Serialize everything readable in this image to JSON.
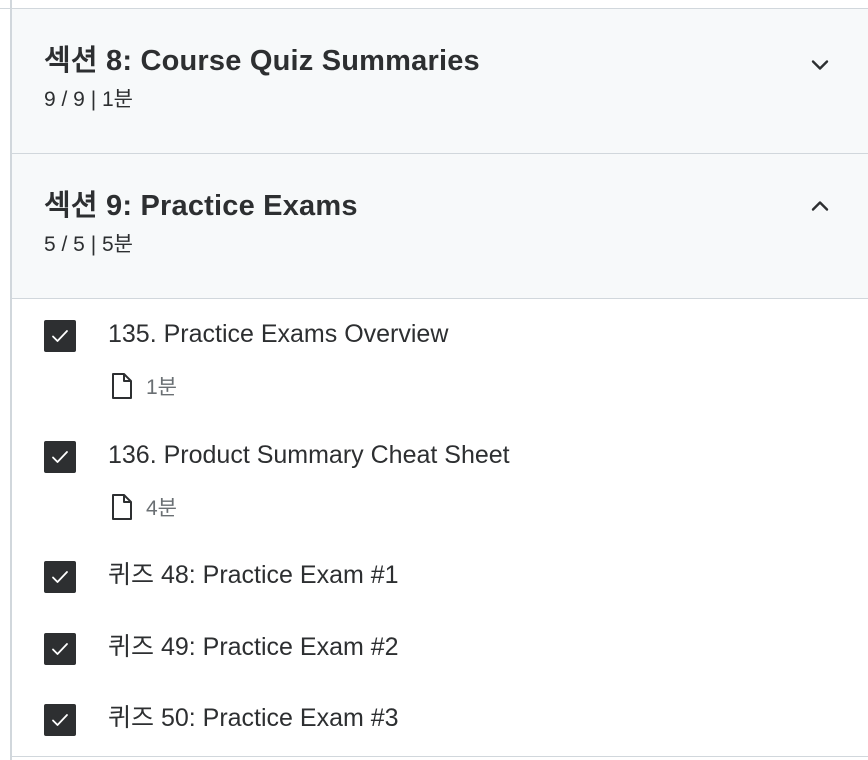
{
  "sections": [
    {
      "title": "섹션 8: Course Quiz Summaries",
      "meta": "9 / 9 | 1분",
      "expanded": false,
      "chevron_icon": "chevron-down-icon"
    },
    {
      "title": "섹션 9: Practice Exams",
      "meta": "5 / 5 | 5분",
      "expanded": true,
      "chevron_icon": "chevron-up-icon",
      "items": [
        {
          "title": "135. Practice Exams Overview",
          "duration": "1분",
          "completed": true,
          "type_icon": "document-icon"
        },
        {
          "title": "136. Product Summary Cheat Sheet",
          "duration": "4분",
          "completed": true,
          "type_icon": "document-icon"
        },
        {
          "title": "퀴즈 48: Practice Exam #1",
          "completed": true
        },
        {
          "title": "퀴즈 49: Practice Exam #2",
          "completed": true
        },
        {
          "title": "퀴즈 50: Practice Exam #3",
          "completed": true
        }
      ]
    }
  ],
  "colors": {
    "header_bg": "#f7f9fa",
    "border": "#d1d7dc",
    "text": "#2d2f31",
    "muted": "#6a6f73",
    "checkbox": "#2d2f31"
  }
}
